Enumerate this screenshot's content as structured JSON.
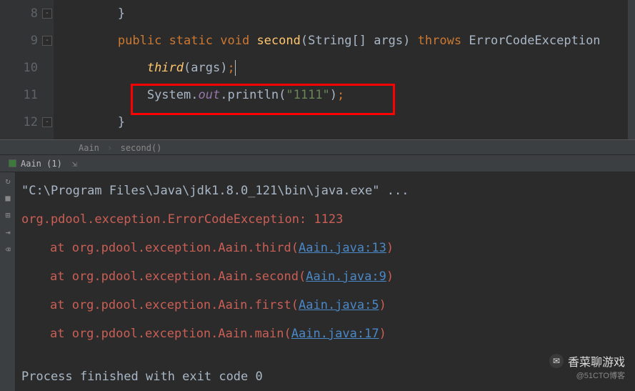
{
  "editor": {
    "line_numbers": [
      "8",
      "9",
      "10",
      "11",
      "12"
    ],
    "lines": {
      "l8": "        }",
      "l9_kw1": "public",
      "l9_kw2": "static",
      "l9_kw3": "void",
      "l9_fn": "second",
      "l9_params": "(String[] args)",
      "l9_kw4": "throws",
      "l9_exc": "ErrorCodeException",
      "l10_fn": "third",
      "l10_args": "(args)",
      "l10_end": ";",
      "l11_sys": "System.",
      "l11_out": "out",
      "l11_dot": ".",
      "l11_println": "println",
      "l11_open": "(",
      "l11_str": "\"1111\"",
      "l11_close": ")",
      "l11_end": ";",
      "l12": "        }"
    },
    "breadcrumb": {
      "class": "Aain",
      "method": "second()"
    }
  },
  "tab": {
    "title": "Aain (1)"
  },
  "console": {
    "cmd": "\"C:\\Program Files\\Java\\jdk1.8.0_121\\bin\\java.exe\" ...",
    "exception": "org.pdool.exception.ErrorCodeException:  1123",
    "trace": [
      {
        "prefix": "at org.pdool.exception.Aain.third(",
        "link": "Aain.java:13",
        "suffix": ")"
      },
      {
        "prefix": "at org.pdool.exception.Aain.second(",
        "link": "Aain.java:9",
        "suffix": ")"
      },
      {
        "prefix": "at org.pdool.exception.Aain.first(",
        "link": "Aain.java:5",
        "suffix": ")"
      },
      {
        "prefix": "at org.pdool.exception.Aain.main(",
        "link": "Aain.java:17",
        "suffix": ")"
      }
    ],
    "exit": "Process finished with exit code 0"
  },
  "watermark": {
    "main": "香菜聊游戏",
    "sub": "@51CTO博客"
  }
}
